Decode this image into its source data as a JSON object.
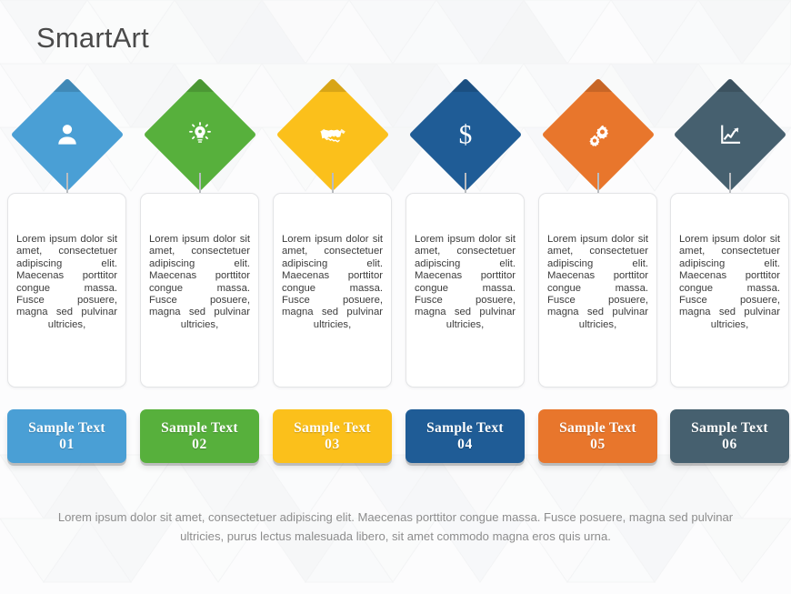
{
  "header": {
    "title": "SmartArt"
  },
  "theme": {
    "background": "#fbfbfc",
    "title_color": "#4a4a4a",
    "card_background": "#ffffff",
    "card_border": "#e3e4e6",
    "stem_color": "#b9bcc0",
    "body_text_color": "#3c3c3c",
    "footer_text_color": "#8d8d8d"
  },
  "body_text": "Lorem ipsum dolor sit amet, consectetuer adipiscing elit. Maecenas porttitor congue massa. Fusce posuere, magna sed pulvinar ultricies,",
  "columns": [
    {
      "icon": "person-icon",
      "color": "#4a9fd5",
      "label_line1": "Sample Text",
      "label_line2": "01",
      "text": "Lorem ipsum dolor sit amet, consectetuer adipiscing elit. Maecenas porttitor congue massa. Fusce posuere, magna sed pulvinar ultricies,"
    },
    {
      "icon": "lightbulb-icon",
      "color": "#57b03c",
      "label_line1": "Sample Text",
      "label_line2": "02",
      "text": "Lorem ipsum dolor sit amet, consectetuer adipiscing elit. Maecenas porttitor congue massa. Fusce posuere, magna sed pulvinar ultricies,"
    },
    {
      "icon": "handshake-icon",
      "color": "#fbc01b",
      "label_line1": "Sample Text",
      "label_line2": "03",
      "text": "Lorem ipsum dolor sit amet, consectetuer adipiscing elit. Maecenas porttitor congue massa. Fusce posuere, magna sed pulvinar ultricies,"
    },
    {
      "icon": "dollar-icon",
      "color": "#1f5c96",
      "label_line1": "Sample Text",
      "label_line2": "04",
      "text": "Lorem ipsum dolor sit amet, consectetuer adipiscing elit. Maecenas porttitor congue massa. Fusce posuere, magna sed pulvinar ultricies,"
    },
    {
      "icon": "gears-icon",
      "color": "#e8762c",
      "label_line1": "Sample Text",
      "label_line2": "05",
      "text": "Lorem ipsum dolor sit amet, consectetuer adipiscing elit. Maecenas porttitor congue massa. Fusce posuere, magna sed pulvinar ultricies,"
    },
    {
      "icon": "chart-growth-icon",
      "color": "#46606f",
      "label_line1": "Sample Text",
      "label_line2": "06",
      "text": "Lorem ipsum dolor sit amet, consectetuer adipiscing elit. Maecenas porttitor congue massa. Fusce posuere, magna sed pulvinar ultricies,"
    }
  ],
  "footer": {
    "text": "Lorem ipsum dolor sit amet, consectetuer adipiscing elit. Maecenas porttitor congue massa. Fusce posuere, magna sed pulvinar ultricies, purus lectus malesuada libero, sit amet commodo magna eros quis urna."
  }
}
